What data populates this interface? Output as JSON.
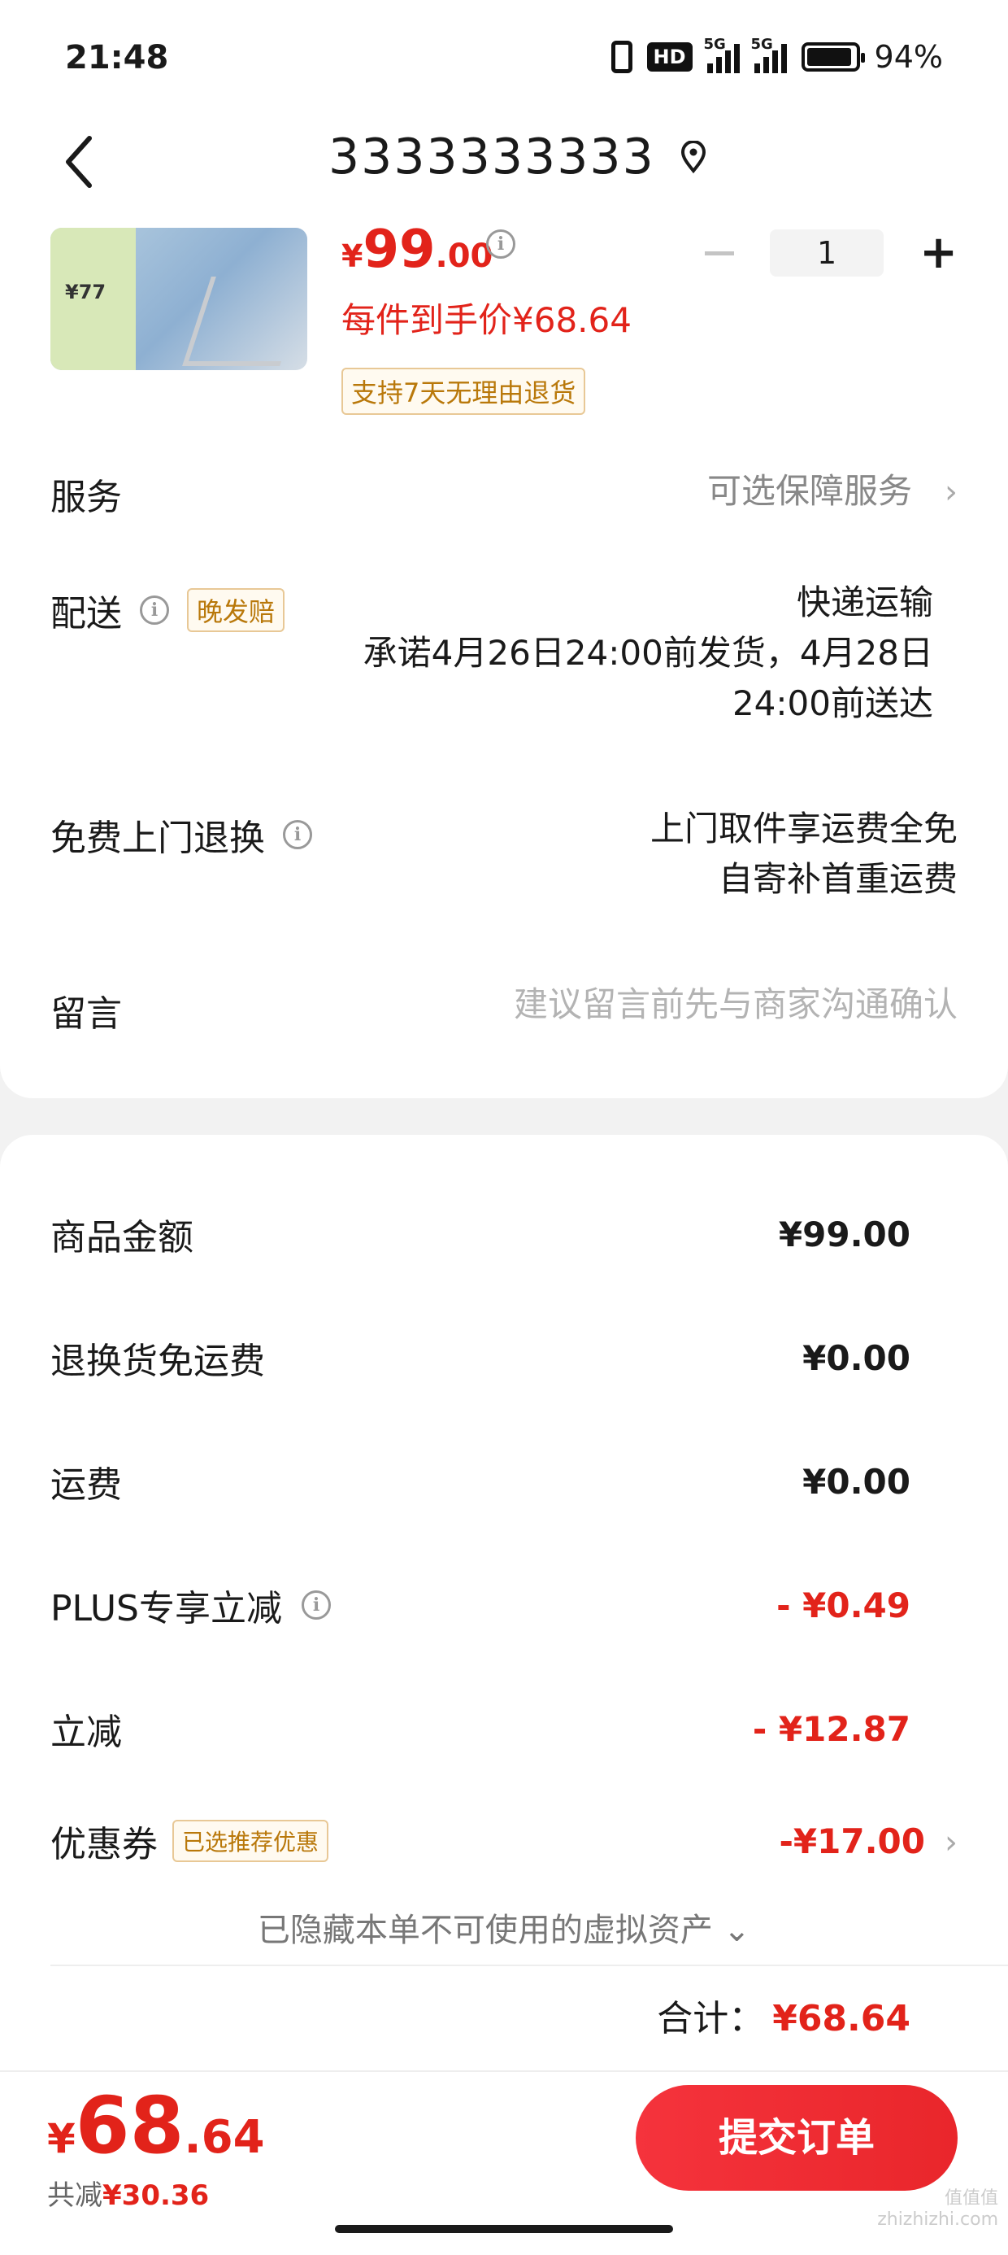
{
  "status_bar": {
    "time": "21:48",
    "hd_label": "HD",
    "sig1_label": "5G",
    "sig2_label": "5G",
    "battery": "94%",
    "battery_level": 0.94
  },
  "header": {
    "title": "3333333333"
  },
  "product": {
    "thumb_price": "¥77",
    "price_symbol": "¥",
    "price_int": "99",
    "price_dec": ".00",
    "per_item_price": "每件到手价¥68.64",
    "return_badge": "支持7天无理由退货",
    "quantity": "1"
  },
  "rows": {
    "service": {
      "label": "服务",
      "value": "可选保障服务"
    },
    "delivery": {
      "label": "配送",
      "tag": "晚发赔",
      "method": "快递运输",
      "promise_line1": "承诺4月26日24:00前发货，4月28日",
      "promise_line2": "24:00前送达"
    },
    "free_return": {
      "label": "免费上门退换",
      "line1": "上门取件享运费全免",
      "line2": "自寄补首重运费"
    },
    "message": {
      "label": "留言",
      "placeholder": "建议留言前先与商家沟通确认"
    }
  },
  "price_rows": [
    {
      "label": "商品金额",
      "value": "¥99.00"
    },
    {
      "label": "退换货免运费",
      "value": "¥0.00"
    },
    {
      "label": "运费",
      "value": "¥0.00"
    },
    {
      "label": "PLUS专享立减",
      "value": "- ¥0.49"
    },
    {
      "label": "立减",
      "value": "- ¥12.87"
    },
    {
      "label": "优惠券",
      "tag": "已选推荐优惠",
      "value": "-¥17.00"
    }
  ],
  "hidden_note": "已隐藏本单不可使用的虚拟资产",
  "total": {
    "label": "合计：",
    "amount": "¥68.64"
  },
  "bottom": {
    "price_symbol": "¥",
    "price_int": "68",
    "price_dec": ".64",
    "reduce_label": "共减",
    "reduce_amount": "¥30.36",
    "submit_label": "提交订单"
  },
  "watermark": {
    "line1": "值值值",
    "line2": "zhizhizhi.com"
  },
  "colors": {
    "accent_red": "#e2231a",
    "tag_gold": "#b9780a"
  }
}
